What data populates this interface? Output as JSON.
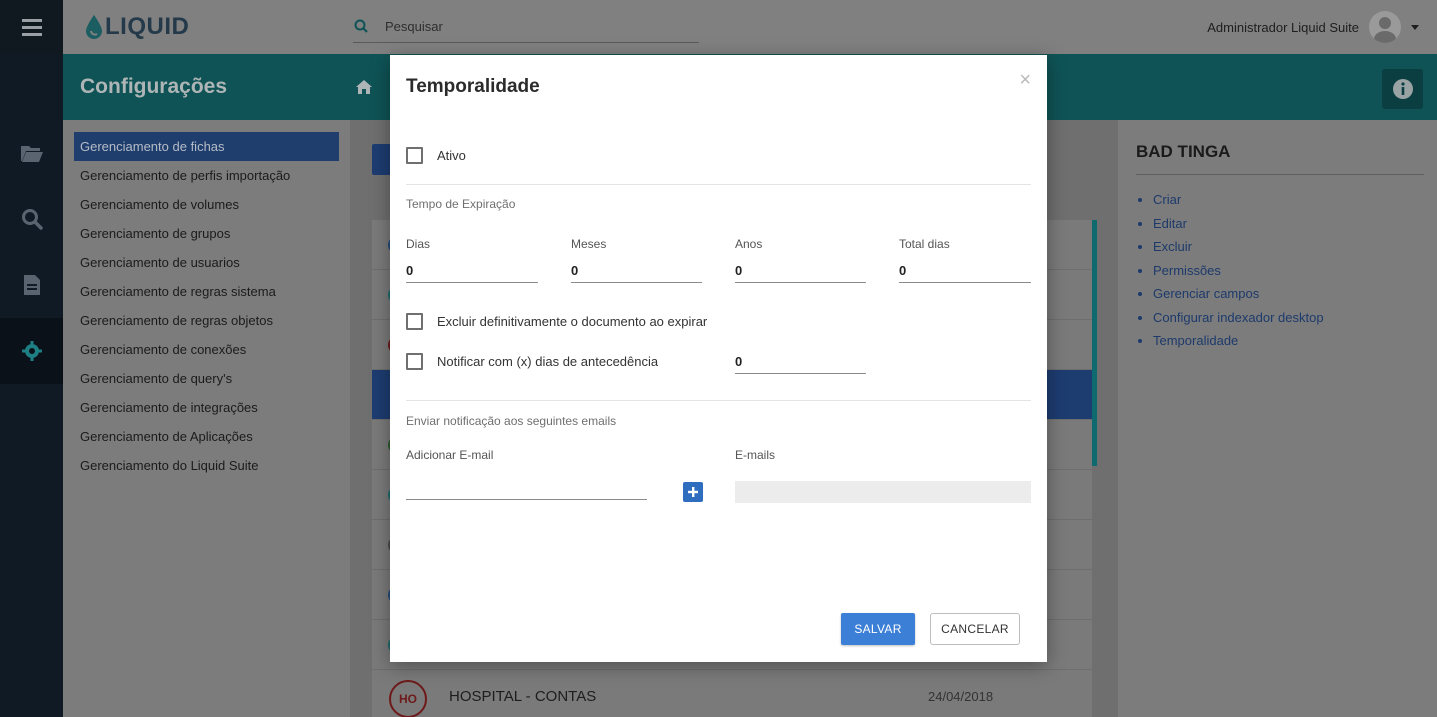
{
  "header": {
    "logo_text": "LIQUID",
    "search": {
      "placeholder": "Pesquisar",
      "value": ""
    },
    "user_name": "Administrador Liquid Suite"
  },
  "banner": {
    "title": "Configurações"
  },
  "left_menu": {
    "items": [
      {
        "label": "Gerenciamento de fichas"
      },
      {
        "label": "Gerenciamento de perfis importação"
      },
      {
        "label": "Gerenciamento de volumes"
      },
      {
        "label": "Gerenciamento de grupos"
      },
      {
        "label": "Gerenciamento de usuarios"
      },
      {
        "label": "Gerenciamento de regras sistema"
      },
      {
        "label": "Gerenciamento de regras objetos"
      },
      {
        "label": "Gerenciamento de conexões"
      },
      {
        "label": "Gerenciamento de query's"
      },
      {
        "label": "Gerenciamento de integrações"
      },
      {
        "label": "Gerenciamento de Aplicações"
      },
      {
        "label": "Gerenciamento do Liquid Suite"
      }
    ],
    "selected_index": 0
  },
  "list": {
    "last_row": {
      "badge": "HO",
      "title": "HOSPITAL - CONTAS",
      "date": "24/04/2018"
    }
  },
  "right_panel": {
    "title": "BAD TINGA",
    "actions": [
      {
        "label": "Criar"
      },
      {
        "label": "Editar"
      },
      {
        "label": "Excluir"
      },
      {
        "label": "Permissões"
      },
      {
        "label": "Gerenciar campos"
      },
      {
        "label": "Configurar indexador desktop"
      },
      {
        "label": "Temporalidade"
      }
    ]
  },
  "modal": {
    "title": "Temporalidade",
    "close_symbol": "×",
    "ativo": {
      "label": "Ativo",
      "checked": false
    },
    "expiration_section": "Tempo de Expiração",
    "fields": {
      "dias": {
        "label": "Dias",
        "value": "0"
      },
      "meses": {
        "label": "Meses",
        "value": "0"
      },
      "anos": {
        "label": "Anos",
        "value": "0"
      },
      "total_dias": {
        "label": "Total dias",
        "value": "0"
      }
    },
    "excluir": {
      "label": "Excluir definitivamente o documento ao expirar",
      "checked": false
    },
    "notificar": {
      "label": "Notificar com (x) dias de antecedência",
      "checked": false,
      "value": "0"
    },
    "notification_section": "Enviar notificação aos seguintes emails",
    "add_email": {
      "label": "Adicionar E-mail",
      "value": ""
    },
    "emails": {
      "label": "E-mails"
    },
    "save_label": "SALVAR",
    "cancel_label": "CANCELAR"
  },
  "colors": {
    "primary_blue": "#3c7fd7",
    "teal_banner": "#20a5aa",
    "nav_dark": "#1d2b3a"
  }
}
